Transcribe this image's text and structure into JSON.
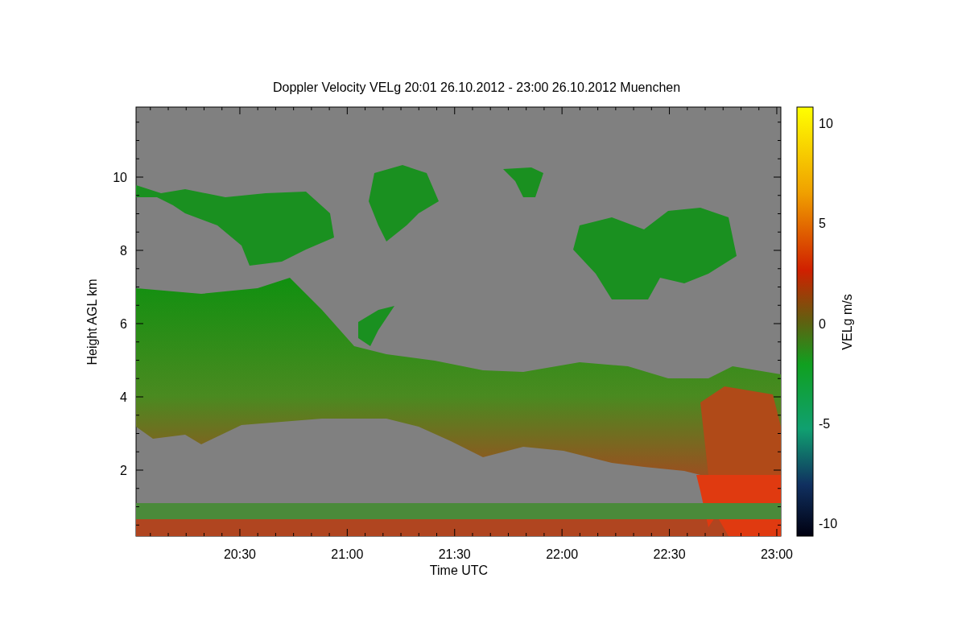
{
  "title": "Doppler Velocity VELg   20:01 26.10.2012 - 23:00 26.10.2012 Muenchen",
  "y_axis": {
    "label": "Height AGL km",
    "ticks": [
      "10",
      "8",
      "6",
      "4",
      "2"
    ]
  },
  "x_axis": {
    "label": "Time UTC",
    "ticks": [
      "20:30",
      "21:00",
      "21:30",
      "22:00",
      "22:30",
      "23:00"
    ]
  },
  "colorbar": {
    "label": "VELg m/s",
    "ticks": [
      "10",
      "5",
      "0",
      "-5",
      "-10"
    ]
  }
}
